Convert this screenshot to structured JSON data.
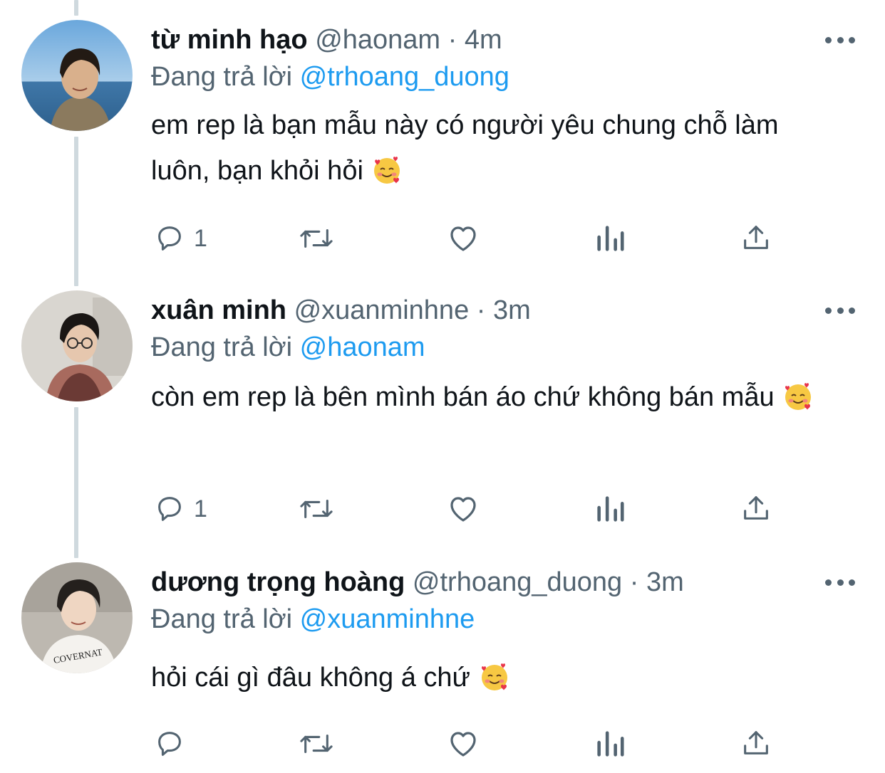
{
  "colors": {
    "text": "#0f1419",
    "secondary": "#536471",
    "link": "#1d9bf0",
    "thread_line": "#cfd9de"
  },
  "tweets": [
    {
      "name": "từ minh hạo",
      "handle": "@haonam",
      "separator": "·",
      "time": "4m",
      "reply_prefix": "Đang trả lời",
      "reply_to": "@trhoang_duong",
      "text": "em rep là bạn mẫu này có người yêu chung chỗ làm luôn, bạn khỏi hỏi",
      "emoji": "smiling-face-with-hearts",
      "reply_count": "1"
    },
    {
      "name": "xuân minh",
      "handle": "@xuanminhne",
      "separator": "·",
      "time": "3m",
      "reply_prefix": "Đang trả lời",
      "reply_to": "@haonam",
      "text": "còn em rep là bên mình bán áo chứ không bán mẫu",
      "emoji": "smiling-face-with-hearts",
      "reply_count": "1"
    },
    {
      "name": "dương trọng hoàng",
      "handle": "@trhoang_duong",
      "separator": "·",
      "time": "3m",
      "reply_prefix": "Đang trả lời",
      "reply_to": "@xuanminhne",
      "text": "hỏi cái gì đâu không á chứ",
      "emoji": "smiling-face-with-hearts",
      "reply_count": "",
      "shirt_text": "COVERNAT"
    }
  ],
  "icons": [
    "reply-icon",
    "retweet-icon",
    "like-icon",
    "views-icon",
    "share-icon",
    "more-icon"
  ]
}
